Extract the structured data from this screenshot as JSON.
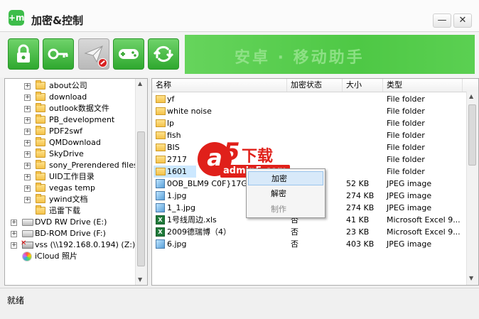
{
  "app": {
    "title": "加密&控制",
    "icon_glyph": "+m",
    "min_glyph": "—",
    "close_glyph": "✕"
  },
  "toolbar": {
    "buttons": [
      {
        "name": "lock",
        "icon": "lock-icon",
        "enabled": true
      },
      {
        "name": "key",
        "icon": "key-icon",
        "enabled": true
      },
      {
        "name": "send",
        "icon": "paper-plane-icon",
        "enabled": false
      },
      {
        "name": "gamepad",
        "icon": "gamepad-icon",
        "enabled": true
      },
      {
        "name": "sync",
        "icon": "sync-arrows-icon",
        "enabled": true
      }
    ],
    "banner_text": "安卓 · 移动助手"
  },
  "tree": {
    "items": [
      {
        "label": "about公司",
        "type": "folder",
        "expander": "+"
      },
      {
        "label": "download",
        "type": "folder",
        "expander": "+"
      },
      {
        "label": "outlook数据文件",
        "type": "folder",
        "expander": "+"
      },
      {
        "label": "PB_development",
        "type": "folder",
        "expander": "+"
      },
      {
        "label": "PDF2swf",
        "type": "folder",
        "expander": "+"
      },
      {
        "label": "QMDownload",
        "type": "folder",
        "expander": "+"
      },
      {
        "label": "SkyDrive",
        "type": "folder",
        "expander": "+"
      },
      {
        "label": "sony_Prerendered files",
        "type": "folder",
        "expander": "+"
      },
      {
        "label": "UID工作目录",
        "type": "folder",
        "expander": "+"
      },
      {
        "label": "vegas temp",
        "type": "folder",
        "expander": "+"
      },
      {
        "label": "ywind文档",
        "type": "folder",
        "expander": "+"
      },
      {
        "label": "迅雷下载",
        "type": "folder",
        "expander": ""
      },
      {
        "label": "DVD RW Drive (E:)",
        "type": "drive",
        "expander": "+"
      },
      {
        "label": "BD-ROM Drive (F:)",
        "type": "drive",
        "expander": "+"
      },
      {
        "label": "vss (\\\\192.168.0.194) (Z:)",
        "type": "netdrive",
        "expander": "+"
      },
      {
        "label": "iCloud 照片",
        "type": "icloud",
        "expander": ""
      }
    ]
  },
  "list": {
    "columns": [
      "名称",
      "加密状态",
      "大小",
      "类型"
    ],
    "rows": [
      {
        "name": "yf",
        "status": "",
        "size": "",
        "type": "File folder",
        "icon": "folder"
      },
      {
        "name": "white noise",
        "status": "",
        "size": "",
        "type": "File folder",
        "icon": "folder"
      },
      {
        "name": "lp",
        "status": "",
        "size": "",
        "type": "File folder",
        "icon": "folder"
      },
      {
        "name": "fish",
        "status": "",
        "size": "",
        "type": "File folder",
        "icon": "folder"
      },
      {
        "name": "BIS",
        "status": "",
        "size": "",
        "type": "File folder",
        "icon": "folder"
      },
      {
        "name": "2717",
        "status": "",
        "size": "",
        "type": "File folder",
        "icon": "folder"
      },
      {
        "name": "1601",
        "status": "",
        "size": "",
        "type": "File folder",
        "icon": "folder",
        "selected": true
      },
      {
        "name": "0OB_BLM9  C0F}17G}W",
        "status": "",
        "size": "52 KB",
        "type": "JPEG image",
        "icon": "image"
      },
      {
        "name": "1.jpg",
        "status": "",
        "size": "274 KB",
        "type": "JPEG image",
        "icon": "image"
      },
      {
        "name": "1_1.jpg",
        "status": "",
        "size": "274 KB",
        "type": "JPEG image",
        "icon": "image"
      },
      {
        "name": "1号线周边.xls",
        "status": "否",
        "size": "41 KB",
        "type": "Microsoft Excel 9...",
        "icon": "excel"
      },
      {
        "name": "2009德瑞博（4）",
        "status": "否",
        "size": "23 KB",
        "type": "Microsoft Excel 9...",
        "icon": "excel"
      },
      {
        "name": "6.jpg",
        "status": "否",
        "size": "403 KB",
        "type": "JPEG image",
        "icon": "image"
      }
    ],
    "right_edge_marks": [
      "(",
      "(",
      "(",
      "(",
      "(",
      "(",
      "(",
      "(",
      "("
    ]
  },
  "context_menu": {
    "items": [
      {
        "label": "加密",
        "state": "hover"
      },
      {
        "label": "解密",
        "state": "normal"
      },
      {
        "label": "制作",
        "state": "disabled"
      }
    ]
  },
  "watermark": {
    "mark": "a",
    "number": "5",
    "text": "下载",
    "url": "admin5.com"
  },
  "status": {
    "text": "就绪"
  },
  "colors": {
    "accent_green": "#3dbd4a",
    "selection_blue": "#cce8ff",
    "watermark_red": "#e0201a"
  }
}
